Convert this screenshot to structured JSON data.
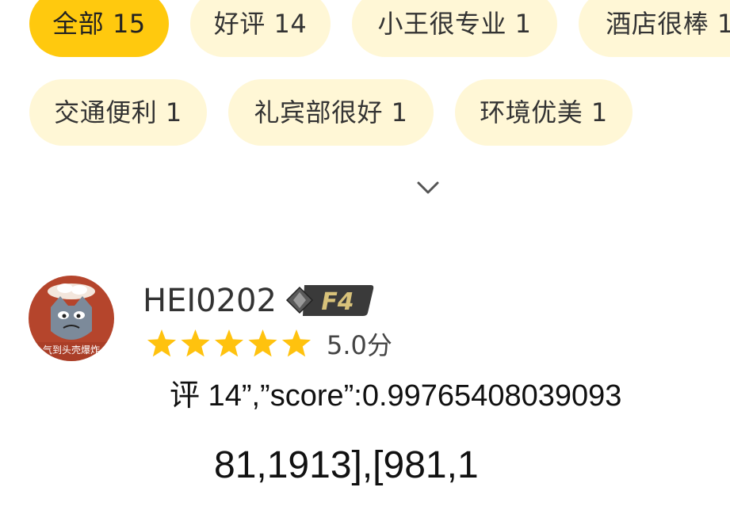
{
  "tags": [
    {
      "label": "全部 15",
      "active": true
    },
    {
      "label": "好评 14",
      "active": false
    },
    {
      "label": "小王很专业 1",
      "active": false
    },
    {
      "label": "酒店很棒 1",
      "active": false
    },
    {
      "label": "交通便利 1",
      "active": false
    },
    {
      "label": "礼宾部很好 1",
      "active": false
    },
    {
      "label": "环境优美 1",
      "active": false
    }
  ],
  "expand_icon": "chevron-down-icon",
  "review": {
    "avatar_text": "气到头壳爆炸",
    "username": "HEI0202",
    "level": "F4",
    "rating": 5,
    "score_label": "5.0分",
    "text_line1": "评 14”,”score”:0.99765408039093",
    "text_line2": "81,1913],[981,1"
  },
  "colors": {
    "accent": "#ffc90e",
    "tag_bg": "#fff7d6",
    "star": "#ffc20e"
  }
}
